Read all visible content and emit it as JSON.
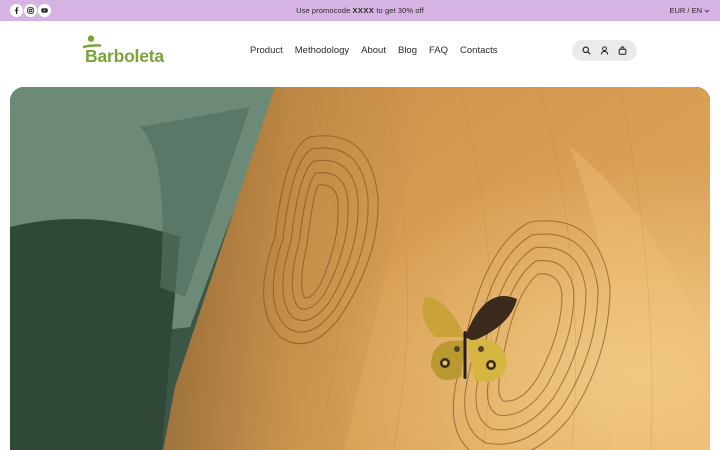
{
  "promo": {
    "text_before": "Use promocode",
    "code": "XXXX",
    "text_after": "to get 30% off",
    "background": "#d5b3e2"
  },
  "social": [
    {
      "name": "facebook-icon"
    },
    {
      "name": "instagram-icon"
    },
    {
      "name": "youtube-icon"
    }
  ],
  "locale": {
    "label": "EUR / EN"
  },
  "logo": {
    "text": "Barboleta",
    "color": "#7aa33a"
  },
  "nav": {
    "items": [
      {
        "label": "Product"
      },
      {
        "label": "Methodology"
      },
      {
        "label": "About"
      },
      {
        "label": "Blog"
      },
      {
        "label": "FAQ"
      },
      {
        "label": "Contacts"
      }
    ]
  },
  "header_icons": [
    "search-icon",
    "account-icon",
    "cart-icon"
  ],
  "hero": {
    "image": "wooden-balance-board-with-butterfly"
  }
}
